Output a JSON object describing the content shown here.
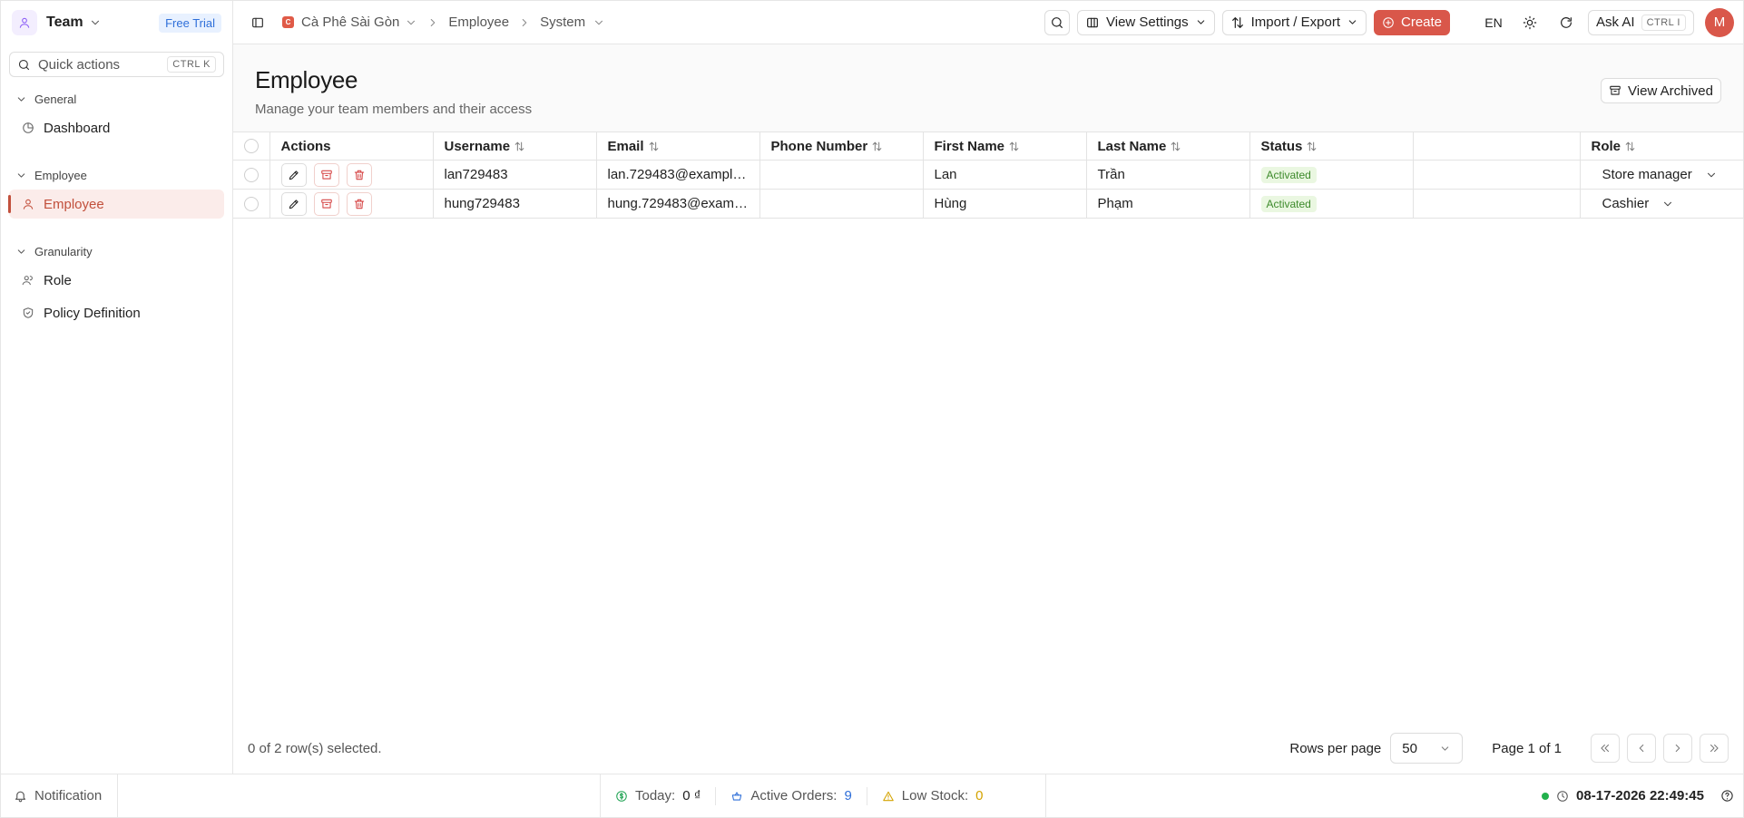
{
  "team": {
    "name": "Team",
    "plan_badge": "Free Trial"
  },
  "quick_actions": {
    "label": "Quick actions",
    "shortcut": "CTRL K"
  },
  "sidebar": {
    "groups": [
      {
        "label": "General",
        "items": [
          {
            "label": "Dashboard",
            "icon": "dashboard-icon"
          }
        ]
      },
      {
        "label": "Employee",
        "items": [
          {
            "label": "Employee",
            "icon": "user-icon",
            "active": true
          }
        ]
      },
      {
        "label": "Granularity",
        "items": [
          {
            "label": "Role",
            "icon": "users-icon"
          },
          {
            "label": "Policy Definition",
            "icon": "shield-icon"
          }
        ]
      }
    ]
  },
  "header": {
    "breadcrumb": {
      "org": "Cà Phê Sài Gòn",
      "section": "Employee",
      "current": "System"
    },
    "view_settings": "View Settings",
    "import_export": "Import / Export",
    "create": "Create",
    "language": "EN",
    "ask_ai": "Ask AI",
    "ask_ai_shortcut": "CTRL I",
    "avatar_initial": "M"
  },
  "page": {
    "title": "Employee",
    "subtitle": "Manage your team members and their access",
    "view_archived": "View Archived"
  },
  "table": {
    "columns": [
      "Actions",
      "Username",
      "Email",
      "Phone Number",
      "First Name",
      "Last Name",
      "Status",
      "",
      "Role"
    ],
    "rows": [
      {
        "username": "lan729483",
        "email": "lan.729483@example.com",
        "phone": "",
        "first_name": "Lan",
        "last_name": "Trần",
        "status": "Activated",
        "role": "Store manager"
      },
      {
        "username": "hung729483",
        "email": "hung.729483@example.com",
        "phone": "",
        "first_name": "Hùng",
        "last_name": "Phạm",
        "status": "Activated",
        "role": "Cashier"
      }
    ]
  },
  "footer": {
    "selection": "0 of 2 row(s) selected.",
    "rows_per_page_label": "Rows per page",
    "rows_per_page": "50",
    "page_info": "Page 1 of 1"
  },
  "statusbar": {
    "notification": "Notification",
    "today_label": "Today:",
    "today_value": "0 ₫",
    "active_orders_label": "Active Orders:",
    "active_orders_value": "9",
    "low_stock_label": "Low Stock:",
    "low_stock_value": "0",
    "datetime": "08-17-2026 22:49:45"
  },
  "colors": {
    "accent": "#d9574a",
    "active_bg": "#fbecea",
    "activated_badge": "#eaf7e1",
    "orders_value": "#2f6fd9",
    "low_stock_value": "#d4a300"
  }
}
